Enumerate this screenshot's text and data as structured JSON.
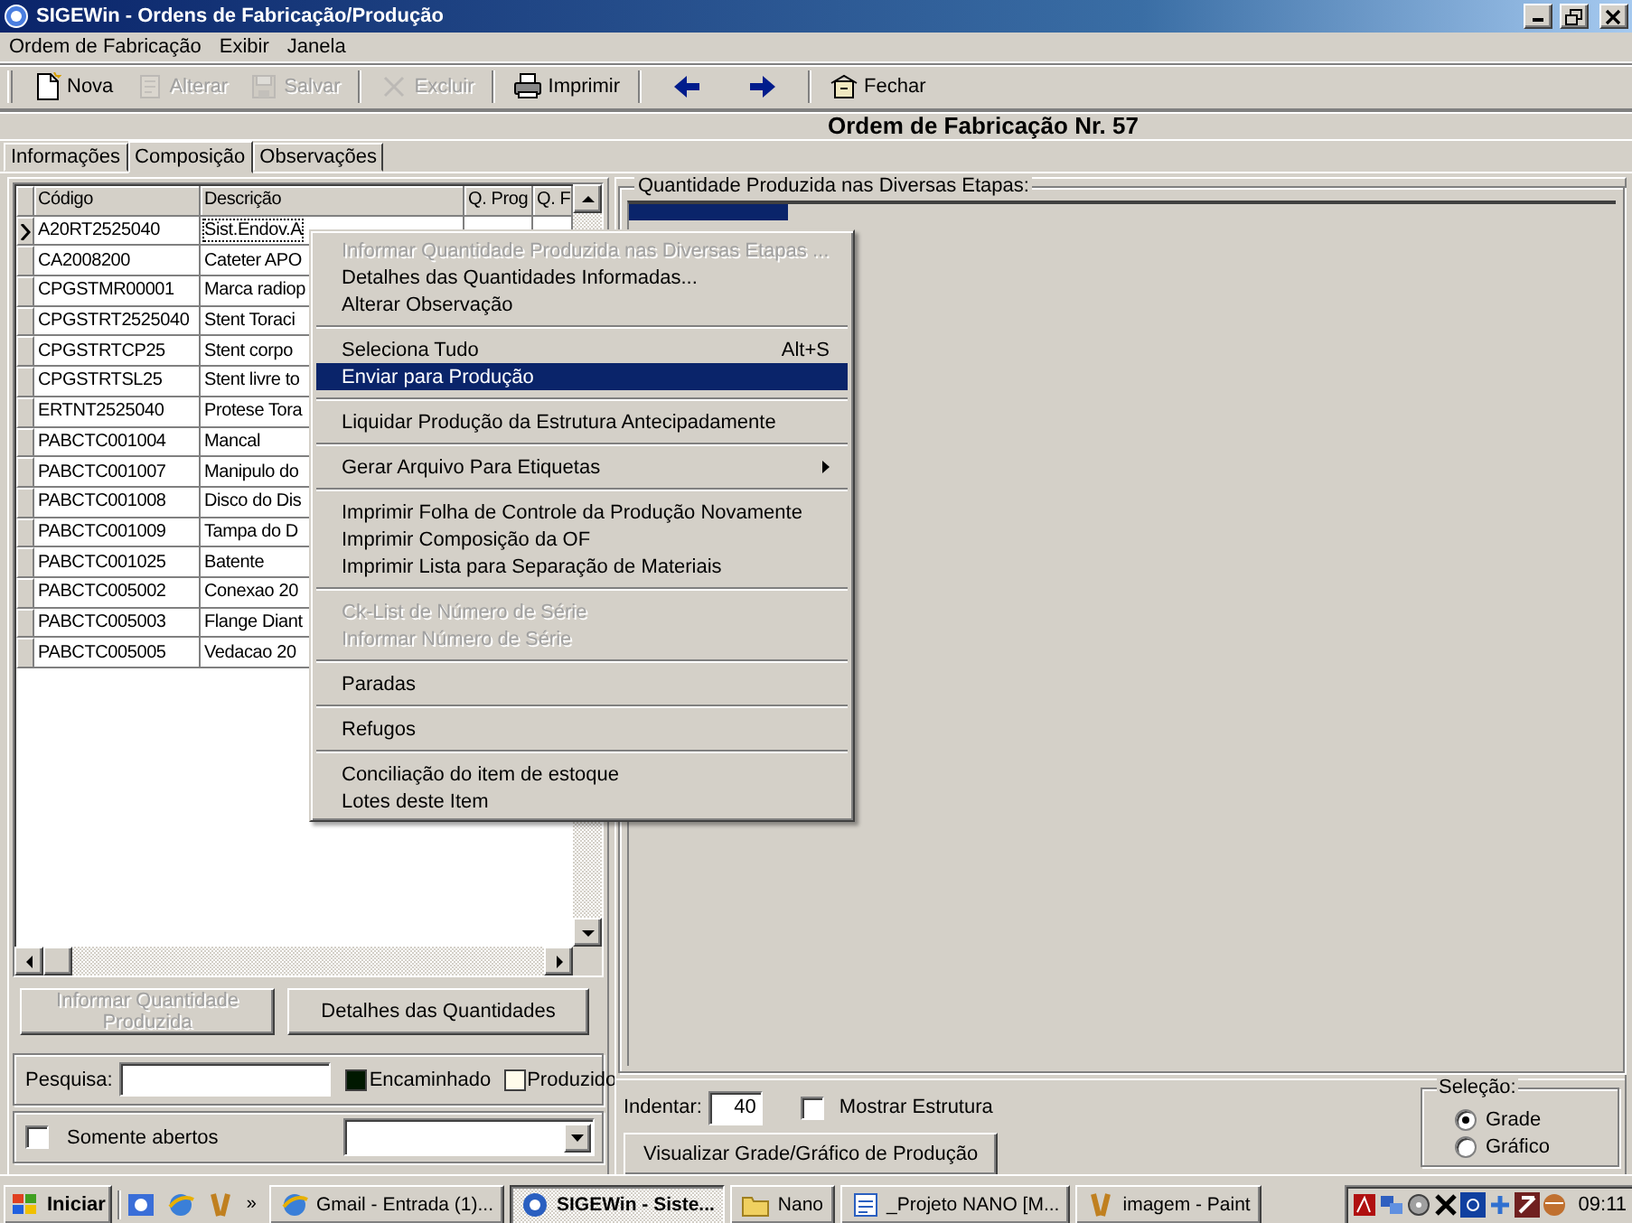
{
  "window": {
    "title": "SIGEWin - Ordens de Fabricação/Produção"
  },
  "menu_bar": [
    "Ordem de Fabricação",
    "Exibir",
    "Janela"
  ],
  "toolbar": [
    {
      "label": "Nova",
      "kind": "new",
      "disabled": false
    },
    {
      "label": "Alterar",
      "kind": "edit",
      "disabled": true
    },
    {
      "label": "Salvar",
      "kind": "save",
      "disabled": true
    },
    {
      "label": "Excluir",
      "kind": "delete",
      "disabled": true
    },
    {
      "label": "Imprimir",
      "kind": "print",
      "disabled": false
    },
    {
      "kind": "back",
      "disabled": false
    },
    {
      "kind": "forward",
      "disabled": false
    },
    {
      "label": "Fechar",
      "kind": "close",
      "disabled": false
    }
  ],
  "header": "Ordem de Fabricação Nr. 57",
  "tabs": [
    {
      "label": "Informações",
      "selected": false
    },
    {
      "label": "Composição",
      "selected": true
    },
    {
      "label": "Observações",
      "selected": false
    }
  ],
  "grid": {
    "columns": [
      "Código",
      "Descrição",
      "Q. Prog",
      "Q. F"
    ],
    "rows": [
      {
        "code": "A20RT2525040",
        "description": "Sist.Endov.A",
        "selected": true
      },
      {
        "code": "CA2008200",
        "description": "Cateter APO",
        "selected": false
      },
      {
        "code": "CPGSTMR00001",
        "description": "Marca radiop",
        "selected": false
      },
      {
        "code": "CPGSTRT2525040",
        "description": "Stent Toraci",
        "selected": false
      },
      {
        "code": "CPGSTRTCP25",
        "description": "Stent corpo",
        "selected": false
      },
      {
        "code": "CPGSTRTSL25",
        "description": "Stent livre to",
        "selected": false
      },
      {
        "code": "ERTNT2525040",
        "description": "Protese Tora",
        "selected": false
      },
      {
        "code": "PABCTC001004",
        "description": "Mancal",
        "selected": false
      },
      {
        "code": "PABCTC001007",
        "description": "Manipulo do",
        "selected": false
      },
      {
        "code": "PABCTC001008",
        "description": "Disco do Dis",
        "selected": false
      },
      {
        "code": "PABCTC001009",
        "description": "Tampa do D",
        "selected": false
      },
      {
        "code": "PABCTC001025",
        "description": "Batente",
        "selected": false
      },
      {
        "code": "PABCTC005002",
        "description": "Conexao 20",
        "selected": false
      },
      {
        "code": "PABCTC005003",
        "description": "Flange Diant",
        "selected": false
      },
      {
        "code": "PABCTC005005",
        "description": "Vedacao 20",
        "selected": false
      }
    ]
  },
  "buttons": [
    {
      "label": "Informar Quantidade Produzida",
      "disabled": true
    },
    {
      "label": "Detalhes das Quantidades",
      "disabled": false
    }
  ],
  "search": {
    "label": "Pesquisa:"
  },
  "legend": [
    {
      "label": "Encaminhado",
      "color": "#001800"
    },
    {
      "label": "Produzido",
      "color": "#fffbeb"
    }
  ],
  "only_open": {
    "label": "Somente abertos",
    "checked": false
  },
  "stages_panel": {
    "title": "Quantidade Produzida nas Diversas Etapas:"
  },
  "indent": {
    "label": "Indentar:",
    "value": "40"
  },
  "show_structure": {
    "label": "Mostrar Estrutura",
    "checked": false
  },
  "view_button": "Visualizar Grade/Gráfico de Produção",
  "selection": {
    "title": "Seleção:",
    "options": [
      {
        "label": "Grade",
        "selected": true
      },
      {
        "label": "Gráfico",
        "selected": false
      }
    ]
  },
  "context_menu": [
    {
      "kind": "item",
      "label": "Informar Quantidade Produzida nas Diversas Etapas ...",
      "disabled": true,
      "selected": false
    },
    {
      "kind": "item",
      "label": "Detalhes das Quantidades Informadas...",
      "disabled": false,
      "selected": false
    },
    {
      "kind": "item",
      "label": "Alterar Observação",
      "disabled": false,
      "selected": false
    },
    {
      "kind": "separator"
    },
    {
      "kind": "item",
      "label": "Seleciona Tudo",
      "shortcut": "Alt+S",
      "disabled": false,
      "selected": false
    },
    {
      "kind": "item",
      "label": "Enviar para Produção",
      "disabled": false,
      "selected": true
    },
    {
      "kind": "separator"
    },
    {
      "kind": "item",
      "label": "Liquidar Produção da Estrutura Antecipadamente",
      "disabled": false,
      "selected": false
    },
    {
      "kind": "separator"
    },
    {
      "kind": "item",
      "label": "Gerar Arquivo Para Etiquetas",
      "submenu": true,
      "disabled": false,
      "selected": false
    },
    {
      "kind": "separator"
    },
    {
      "kind": "item",
      "label": "Imprimir Folha de Controle da Produção Novamente",
      "disabled": false,
      "selected": false
    },
    {
      "kind": "item",
      "label": "Imprimir Composição da OF",
      "disabled": false,
      "selected": false
    },
    {
      "kind": "item",
      "label": "Imprimir Lista para Separação de Materiais",
      "disabled": false,
      "selected": false
    },
    {
      "kind": "separator"
    },
    {
      "kind": "item",
      "label": "Ck-List de Número de Série",
      "disabled": true,
      "selected": false
    },
    {
      "kind": "item",
      "label": "Informar Número de Série",
      "disabled": true,
      "selected": false
    },
    {
      "kind": "separator"
    },
    {
      "kind": "item",
      "label": "Paradas",
      "disabled": false,
      "selected": false
    },
    {
      "kind": "separator"
    },
    {
      "kind": "item",
      "label": "Refugos",
      "disabled": false,
      "selected": false
    },
    {
      "kind": "separator"
    },
    {
      "kind": "item",
      "label": "Conciliação do item de estoque",
      "disabled": false,
      "selected": false
    },
    {
      "kind": "item",
      "label": "Lotes deste Item",
      "disabled": false,
      "selected": false
    }
  ],
  "taskbar": {
    "start": "Iniciar",
    "more": "»",
    "tasks": [
      {
        "label": "Gmail - Entrada (1)...",
        "kind": "browser",
        "selected": false
      },
      {
        "label": "SIGEWin - Siste...",
        "kind": "app",
        "selected": true
      },
      {
        "label": "Nano",
        "kind": "folder",
        "selected": false
      },
      {
        "label": "_Projeto NANO [M...",
        "kind": "document",
        "selected": false
      },
      {
        "label": "imagem - Paint",
        "kind": "paint",
        "selected": false
      }
    ],
    "clock": "09:11"
  }
}
